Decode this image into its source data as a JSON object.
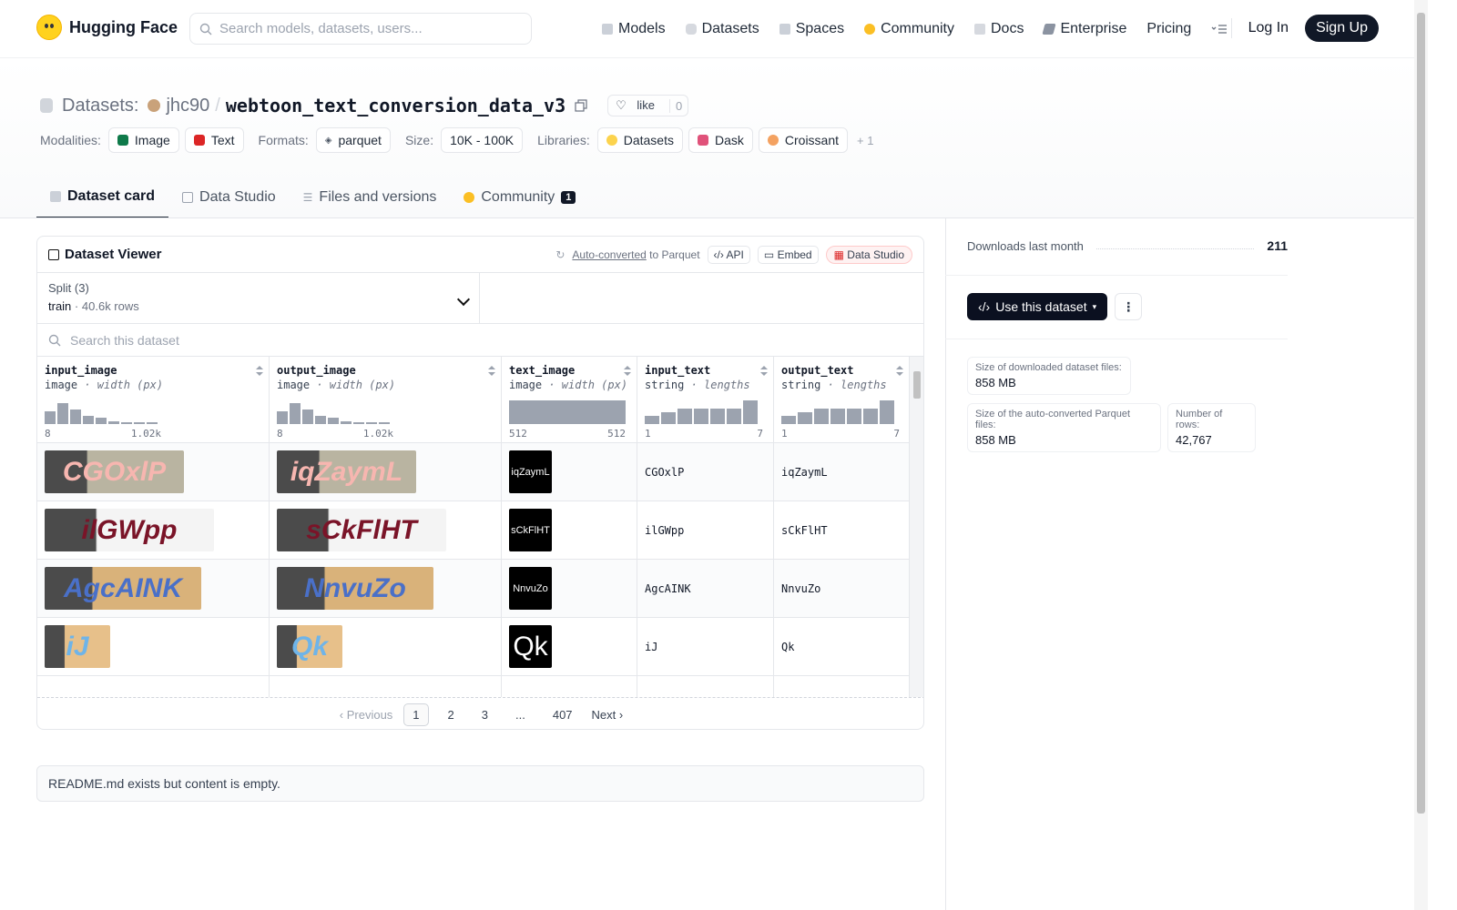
{
  "nav": {
    "brand": "Hugging Face",
    "search_placeholder": "Search models, datasets, users...",
    "links": [
      {
        "label": "Models",
        "icon": "cube-icon",
        "color": "#9ca3af"
      },
      {
        "label": "Datasets",
        "icon": "database-icon",
        "color": "#9ca3af"
      },
      {
        "label": "Spaces",
        "icon": "spaces-icon",
        "color": "#9ca3af"
      },
      {
        "label": "Community",
        "icon": "community-icon",
        "color": "#fbbf24"
      },
      {
        "label": "Docs",
        "icon": "book-icon",
        "color": "#9ca3af"
      },
      {
        "label": "Enterprise",
        "icon": "enterprise-icon",
        "color": "#6b7280"
      },
      {
        "label": "Pricing"
      }
    ],
    "login": "Log In",
    "signup": "Sign Up"
  },
  "dataset": {
    "section": "Datasets:",
    "user": "jhc90",
    "slash": "/",
    "name": "webtoon_text_conversion_data_v3",
    "like_label": "like",
    "like_count": "0"
  },
  "tags": {
    "modalities_label": "Modalities:",
    "modalities": [
      "Image",
      "Text"
    ],
    "formats_label": "Formats:",
    "format": "parquet",
    "size_label": "Size:",
    "size": "10K - 100K",
    "libraries_label": "Libraries:",
    "libraries": [
      "Datasets",
      "Dask",
      "Croissant"
    ],
    "libraries_more": "+ 1"
  },
  "tabs": [
    {
      "label": "Dataset card",
      "icon": "card-icon"
    },
    {
      "label": "Data Studio",
      "icon": "table-icon"
    },
    {
      "label": "Files and versions",
      "icon": "files-icon"
    },
    {
      "label": "Community",
      "icon": "community-icon",
      "badge": "1"
    }
  ],
  "viewer": {
    "title": "Dataset Viewer",
    "auto_converted": "Auto-converted",
    "to_parquet": "to Parquet",
    "api": "API",
    "embed": "Embed",
    "data_studio": "Data Studio",
    "split_label": "Split (3)",
    "split_name": "train",
    "split_dot": "·",
    "split_rows": "40.6k rows",
    "search_placeholder": "Search this dataset",
    "columns": [
      {
        "name": "input_image",
        "type": "image",
        "detail": "· width (px)",
        "min": "8",
        "max": "1.02k",
        "hist": [
          0.55,
          0.9,
          0.6,
          0.35,
          0.25,
          0.12,
          0.06,
          0.05,
          0.04
        ]
      },
      {
        "name": "output_image",
        "type": "image",
        "detail": "· width (px)",
        "min": "8",
        "max": "1.02k",
        "hist": [
          0.55,
          0.9,
          0.6,
          0.35,
          0.25,
          0.12,
          0.06,
          0.05,
          0.04
        ]
      },
      {
        "name": "text_image",
        "type": "image",
        "detail": "· width (px)",
        "min": "512",
        "max": "512",
        "hist": [
          1.0
        ]
      },
      {
        "name": "input_text",
        "type": "string",
        "detail": "· lengths",
        "min": "1",
        "max": "7",
        "hist": [
          0.35,
          0.5,
          0.65,
          0.65,
          0.65,
          0.65,
          1.0
        ]
      },
      {
        "name": "output_text",
        "type": "string",
        "detail": "· lengths",
        "min": "1",
        "max": "7",
        "hist": [
          0.35,
          0.5,
          0.65,
          0.65,
          0.65,
          0.65,
          1.0
        ]
      }
    ],
    "rows": [
      {
        "input_text": "CGOxlP",
        "output_text": "iqZaymL",
        "in_img": "CGOxlP",
        "out_img": "iqZaymL",
        "txt_img": "iqZaymL",
        "in_color": "#f7b6b0",
        "in_bg": "#b9b4a1",
        "in_w": 153,
        "out_w": 153
      },
      {
        "input_text": "ilGWpp",
        "output_text": "sCkFlHT",
        "in_img": "ilGWpp",
        "out_img": "sCkFlHT",
        "txt_img": "sCkFlHT",
        "in_color": "#7a1428",
        "in_bg": "#f4f4f4",
        "in_w": 186,
        "out_w": 186
      },
      {
        "input_text": "AgcAINK",
        "output_text": "NnvuZo",
        "in_img": "AgcAINK",
        "out_img": "NnvuZo",
        "txt_img": "NnvuZo",
        "in_color": "#4a70c8",
        "in_bg": "#d9b27a",
        "in_w": 172,
        "out_w": 172
      },
      {
        "input_text": "iJ",
        "output_text": "Qk",
        "in_img": "iJ",
        "out_img": "Qk",
        "txt_img": "Qk",
        "in_color": "#6fb4e8",
        "in_bg": "#e7c08a",
        "in_w": 72,
        "out_w": 72
      }
    ],
    "pager": {
      "prev": "Previous",
      "pages": [
        "1",
        "2",
        "3",
        "...",
        "407"
      ],
      "next": "Next"
    }
  },
  "readme": "README.md exists but content is empty.",
  "sidebar": {
    "downloads_label": "Downloads last month",
    "downloads": "211",
    "use_button": "Use this dataset",
    "stats": [
      {
        "label": "Size of downloaded dataset files:",
        "value": "858 MB"
      },
      {
        "label": "Size of the auto-converted Parquet files:",
        "value": "858 MB"
      },
      {
        "label": "Number of rows:",
        "value": "42,767"
      }
    ]
  }
}
